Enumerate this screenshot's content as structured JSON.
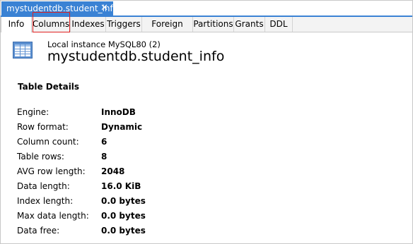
{
  "document_tab": {
    "title": "mystudentdb.student_info",
    "close_glyph": "✕"
  },
  "tabs": [
    {
      "label": "Info",
      "active": true
    },
    {
      "label": "Columns",
      "highlighted": true
    },
    {
      "label": "Indexes"
    },
    {
      "label": "Triggers"
    },
    {
      "label": "Foreign keys"
    },
    {
      "label": "Partitions"
    },
    {
      "label": "Grants"
    },
    {
      "label": "DDL"
    }
  ],
  "header": {
    "icon": "table-icon",
    "instance": "Local instance MySQL80 (2)",
    "title": "mystudentdb.student_info"
  },
  "table_details": {
    "section_title": "Table Details",
    "rows": [
      {
        "label": "Engine:",
        "value": "InnoDB"
      },
      {
        "label": "Row format:",
        "value": "Dynamic"
      },
      {
        "label": "Column count:",
        "value": "6"
      },
      {
        "label": "Table rows:",
        "value": "8"
      },
      {
        "label": "AVG row length:",
        "value": "2048"
      },
      {
        "label": "Data length:",
        "value": "16.0 KiB"
      },
      {
        "label": "Index length:",
        "value": "0.0 bytes"
      },
      {
        "label": "Max data length:",
        "value": "0.0 bytes"
      },
      {
        "label": "Data free:",
        "value": "0.0 bytes"
      }
    ]
  },
  "colors": {
    "accent": "#3a82d4",
    "highlight_box": "#e02020"
  }
}
